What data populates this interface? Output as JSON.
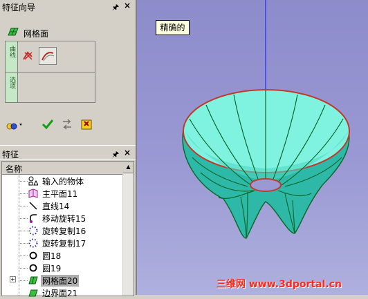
{
  "wizard_panel": {
    "title": "特征向导",
    "pin": "ₐ",
    "close": "×",
    "feature_name": "网格面",
    "row1_side": "曲线",
    "row2_side": "选项"
  },
  "feature_panel": {
    "title": "特征",
    "pin": "ₐ",
    "close": "×",
    "column_header": "名称",
    "items": [
      {
        "label": "输入的物体",
        "icon": "import-icon"
      },
      {
        "label": "主平面11",
        "icon": "plane-icon"
      },
      {
        "label": "直线14",
        "icon": "line-icon"
      },
      {
        "label": "移动旋转15",
        "icon": "move-rotate-icon"
      },
      {
        "label": "旋转复制16",
        "icon": "rotate-copy-icon"
      },
      {
        "label": "旋转复制17",
        "icon": "rotate-copy-icon"
      },
      {
        "label": "圆18",
        "icon": "circle-icon"
      },
      {
        "label": "圆19",
        "icon": "circle-icon"
      },
      {
        "label": "网格面20",
        "icon": "mesh-surface-icon",
        "selected": true
      },
      {
        "label": "边界面21",
        "icon": "boundary-surface-icon"
      }
    ]
  },
  "viewport": {
    "tooltip": "精确的",
    "watermark": "三维网 www.3dportal.cn"
  },
  "colors": {
    "surface": "#36c9b6",
    "edge": "#c0392b",
    "isoline": "#0b6b2c",
    "axis": "#2424ff"
  }
}
